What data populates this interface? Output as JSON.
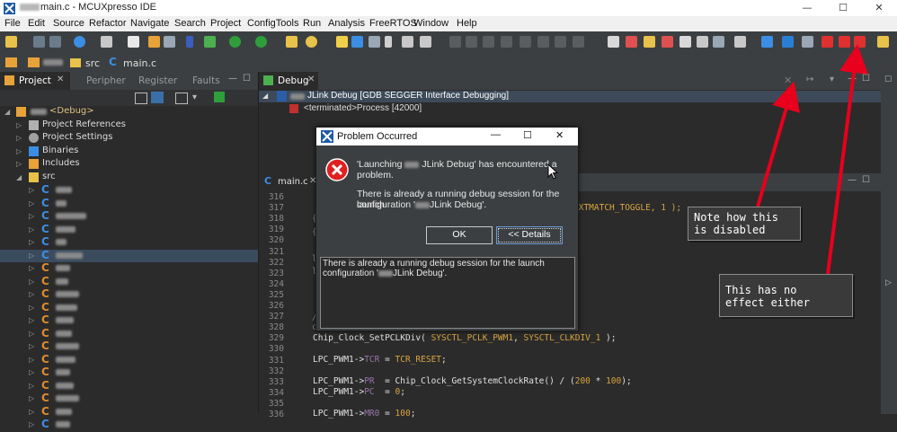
{
  "window": {
    "title_suffix": "main.c - MCUXpresso IDE",
    "minimize": "—",
    "maximize": "☐",
    "close": "✕"
  },
  "menu": [
    "File",
    "Edit",
    "Source",
    "Refactor",
    "Navigate",
    "Search",
    "Project",
    "ConfigTools",
    "Run",
    "Analysis",
    "FreeRTOS",
    "Window",
    "Help"
  ],
  "breadcrumb": {
    "src": "src",
    "file": "main.c"
  },
  "left_tabs": [
    "Project",
    "Peripher",
    "Register",
    "Faults"
  ],
  "tree": {
    "root_label": "<Debug>",
    "items": [
      "Project References",
      "Project Settings",
      "Binaries",
      "Includes",
      "src"
    ]
  },
  "debug": {
    "tab": "Debug",
    "launch_label": "JLink Debug [GDB SEGGER Interface Debugging]",
    "process_label": "<terminated>Process [42000]"
  },
  "editor": {
    "tab": "main.c",
    "line_numbers": [
      "316",
      "317",
      "318",
      "319",
      "320",
      "321",
      "322",
      "323",
      "324",
      "325",
      "326",
      "327",
      "328",
      "329",
      "330",
      "331",
      "332",
      "333",
      "334",
      "335",
      "336"
    ],
    "right_fragment": "EXTMATCH_TOGGLE, 1 );",
    "line_330": [
      "Chip_Clock_SetPCLKDiv( ",
      "SYSCTL_PCLK_PWM1",
      ", ",
      "SYSCTL_CLKDIV_1",
      " );"
    ],
    "line_332": [
      "LPC_PWM1->",
      "TCR",
      " = ",
      "TCR_RESET",
      ";"
    ],
    "line_334_a": [
      "LPC_PWM1->",
      "PR",
      "  = Chip_Clock_GetSystemClockRate() / (",
      "200",
      " * ",
      "100",
      ");"
    ],
    "line_335": [
      "LPC_PWM1->",
      "PC",
      "  = ",
      "0",
      ";"
    ],
    "line_336": [
      "LPC_PWM1->",
      "MR0",
      " = ",
      "100",
      ";"
    ]
  },
  "dialog": {
    "title": "Problem Occurred",
    "msg_line1_a": "'Launching",
    "msg_line1_b": "JLink Debug' has encountered a",
    "msg_line2": "problem.",
    "msg_line3": "There is already a running debug session for the launch",
    "msg_line4_a": "configuration '",
    "msg_line4_b": "JLink Debug'.",
    "ok": "OK",
    "details": "<< Details",
    "details_line1": "There is already a running debug session for the launch",
    "details_line2_a": "configuration '",
    "details_line2_b": "JLink Debug'."
  },
  "notes": {
    "note1": [
      "Note how this",
      "is disabled"
    ],
    "note2": [
      "This has no",
      "effect either"
    ]
  },
  "colors": {
    "arrow": "#e8001c",
    "accent": "#3b8ee3"
  }
}
